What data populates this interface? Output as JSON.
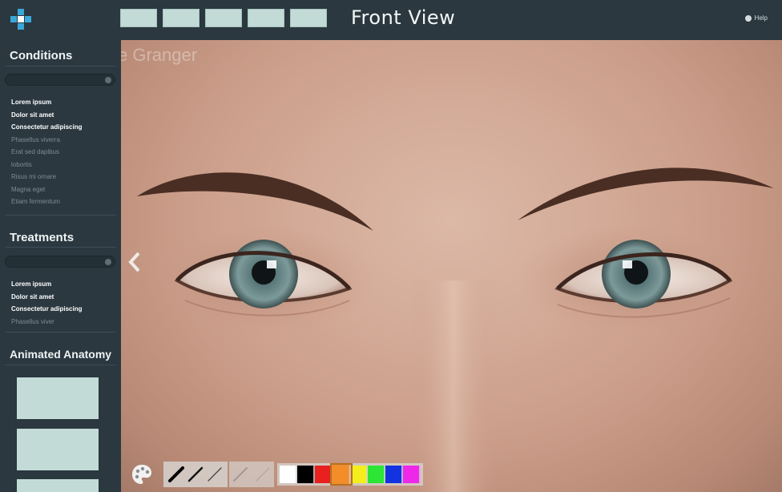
{
  "topbar": {
    "title": "Front View",
    "help_label": "Help",
    "tab_count": 5,
    "tab_color": "#c2dbd6"
  },
  "sidebar": {
    "conditions": {
      "title": "Conditions",
      "items": [
        {
          "label": "Lorem ipsum",
          "style": "bright"
        },
        {
          "label": "Dolor sit amet",
          "style": "bright"
        },
        {
          "label": "Consectetur adipiscing",
          "style": "bright"
        },
        {
          "label": "Phasellus viverra",
          "style": "dim"
        },
        {
          "label": "Erat sed dapibus",
          "style": "dim"
        },
        {
          "label": "lobortis",
          "style": "dim"
        },
        {
          "label": "Risus mi ornare",
          "style": "dim"
        },
        {
          "label": "Magna eget",
          "style": "dim"
        },
        {
          "label": "Etiam fermentum",
          "style": "dim"
        }
      ]
    },
    "treatments": {
      "title": "Treatments",
      "items": [
        {
          "label": "Lorem ipsum",
          "style": "bright"
        },
        {
          "label": "Dolor sit amet",
          "style": "bright"
        },
        {
          "label": "Consectetur adipiscing",
          "style": "bright"
        },
        {
          "label": "Phasellus viver",
          "style": "dim"
        }
      ]
    },
    "anatomy": {
      "title": "Animated Anatomy"
    }
  },
  "viewer": {
    "watermark": "e Granger",
    "skin_color": "#d2a996",
    "iris_color": "#6f8a8a"
  },
  "toolbar": {
    "palette_icon": "palette-icon",
    "brushes": [
      "brush-thick-icon",
      "brush-medium-icon",
      "brush-thin-icon"
    ],
    "erasers": [
      "eraser-medium-icon",
      "eraser-thin-icon"
    ],
    "swatches": [
      {
        "name": "white",
        "color": "#ffffff"
      },
      {
        "name": "black",
        "color": "#000000"
      },
      {
        "name": "red",
        "color": "#e8211f"
      },
      {
        "name": "orange",
        "color": "#f28d2a"
      },
      {
        "name": "yellow",
        "color": "#f4ef1c"
      },
      {
        "name": "green",
        "color": "#2ce534"
      },
      {
        "name": "blue",
        "color": "#1433e0"
      },
      {
        "name": "magenta",
        "color": "#ee28e8"
      }
    ],
    "selected_swatch": "orange"
  }
}
